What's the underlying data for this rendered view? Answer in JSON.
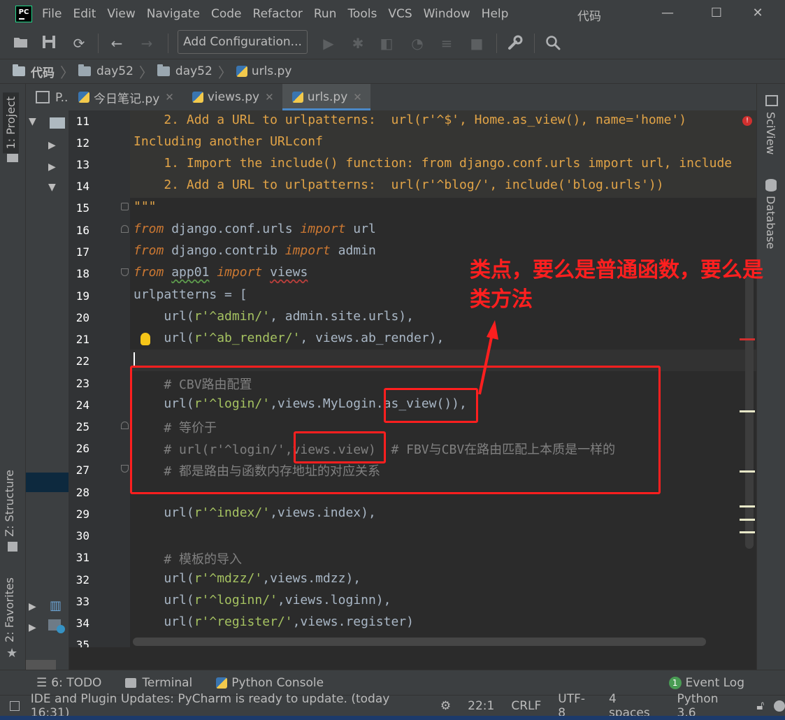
{
  "menu": {
    "items": [
      {
        "label": "File",
        "u": "F"
      },
      {
        "label": "Edit",
        "u": "E"
      },
      {
        "label": "View",
        "u": "V"
      },
      {
        "label": "Navigate",
        "u": "N"
      },
      {
        "label": "Code",
        "u": "C"
      },
      {
        "label": "Refactor",
        "u": "R"
      },
      {
        "label": "Run",
        "u": "u"
      },
      {
        "label": "Tools",
        "u": "T"
      },
      {
        "label": "VCS",
        "u": "S"
      },
      {
        "label": "Window",
        "u": "W"
      },
      {
        "label": "Help",
        "u": "H"
      }
    ],
    "window_title": "代码",
    "logo": "PC"
  },
  "toolbar": {
    "add_configuration": "Add Configuration..."
  },
  "breadcrumb": {
    "items": [
      "代码",
      "day52",
      "day52",
      "urls.py"
    ]
  },
  "side_tabs": {
    "project": "1: Project",
    "structure": "Z: Structure",
    "favorites": "2: Favorites",
    "sciview": "SciView",
    "database": "Database"
  },
  "project_panel": {
    "header": "P.."
  },
  "tabs": [
    {
      "label": "今日笔记.py",
      "active": false
    },
    {
      "label": "views.py",
      "active": false
    },
    {
      "label": "urls.py",
      "active": true
    }
  ],
  "editor": {
    "line_numbers": [
      "11",
      "12",
      "13",
      "14",
      "15",
      "16",
      "17",
      "18",
      "19",
      "20",
      "21",
      "22",
      "23",
      "24",
      "25",
      "26",
      "27",
      "28",
      "29",
      "30",
      "31",
      "32",
      "33",
      "34",
      "35"
    ],
    "lines": {
      "l11": "    2. Add a URL to urlpatterns:  url(r'^$', Home.as_view(), name='home')",
      "l12": "Including another URLconf",
      "l13": "    1. Import the include() function: from django.conf.urls import url, include",
      "l14": "    2. Add a URL to urlpatterns:  url(r'^blog/', include('blog.urls'))",
      "l15": "\"\"\"",
      "l16_kw1": "from",
      "l16_mid": " django.conf.urls ",
      "l16_kw2": "import",
      "l16_end": " url",
      "l17_kw1": "from",
      "l17_mid": " django.contrib ",
      "l17_kw2": "import",
      "l17_end": " admin",
      "l18_kw1": "from",
      "l18_mod": "app01",
      "l18_kw2": "import",
      "l18_end": "views",
      "l19": "urlpatterns = [",
      "l20_a": "    url(",
      "l20_s": "r'^admin/'",
      "l20_b": ", admin.site.urls),",
      "l21_a": "    url(",
      "l21_s": "r'^ab_render/'",
      "l21_b": ", views.ab_render),",
      "l23": "    # CBV路由配置",
      "l24_a": "    url(",
      "l24_s": "r'^login/'",
      "l24_b": ",views.MyLogin.",
      "l24_c": "as_view",
      "l24_d": "()),",
      "l25": "    # 等价于",
      "l26": "    # url(r'^login/',views.view)  # FBV与CBV在路由匹配上本质是一样的",
      "l27": "    # 都是路由与函数内存地址的对应关系",
      "l29_a": "    url(",
      "l29_s": "r'^index/'",
      "l29_b": ",views.index),",
      "l31": "    # 模板的导入",
      "l32_a": "    url(",
      "l32_s": "r'^mdzz/'",
      "l32_b": ",views.mdzz),",
      "l33_a": "    url(",
      "l33_s": "r'^loginn/'",
      "l33_b": ",views.loginn),",
      "l34_a": "    url(",
      "l34_s": "r'^register/'",
      "l34_b": ",views.register)"
    }
  },
  "annotation": {
    "text": "类点，要么是普通函数，要么是类方法"
  },
  "bottom_tools": {
    "todo": "6: TODO",
    "terminal": "Terminal",
    "python_console": "Python Console",
    "event_log": "Event Log",
    "event_count": "1"
  },
  "status": {
    "message": "IDE and Plugin Updates: PyCharm is ready to update. (today 16:31)",
    "position": "22:1",
    "line_sep": "CRLF",
    "encoding": "UTF-8",
    "indent": "4 spaces",
    "interpreter": "Python 3.6"
  },
  "colors": {
    "accent": "#4a88c7",
    "annotation_red": "#ff1f1f",
    "keyword": "#cc7832",
    "string": "#6a8759",
    "docstring": "#e2a447"
  }
}
